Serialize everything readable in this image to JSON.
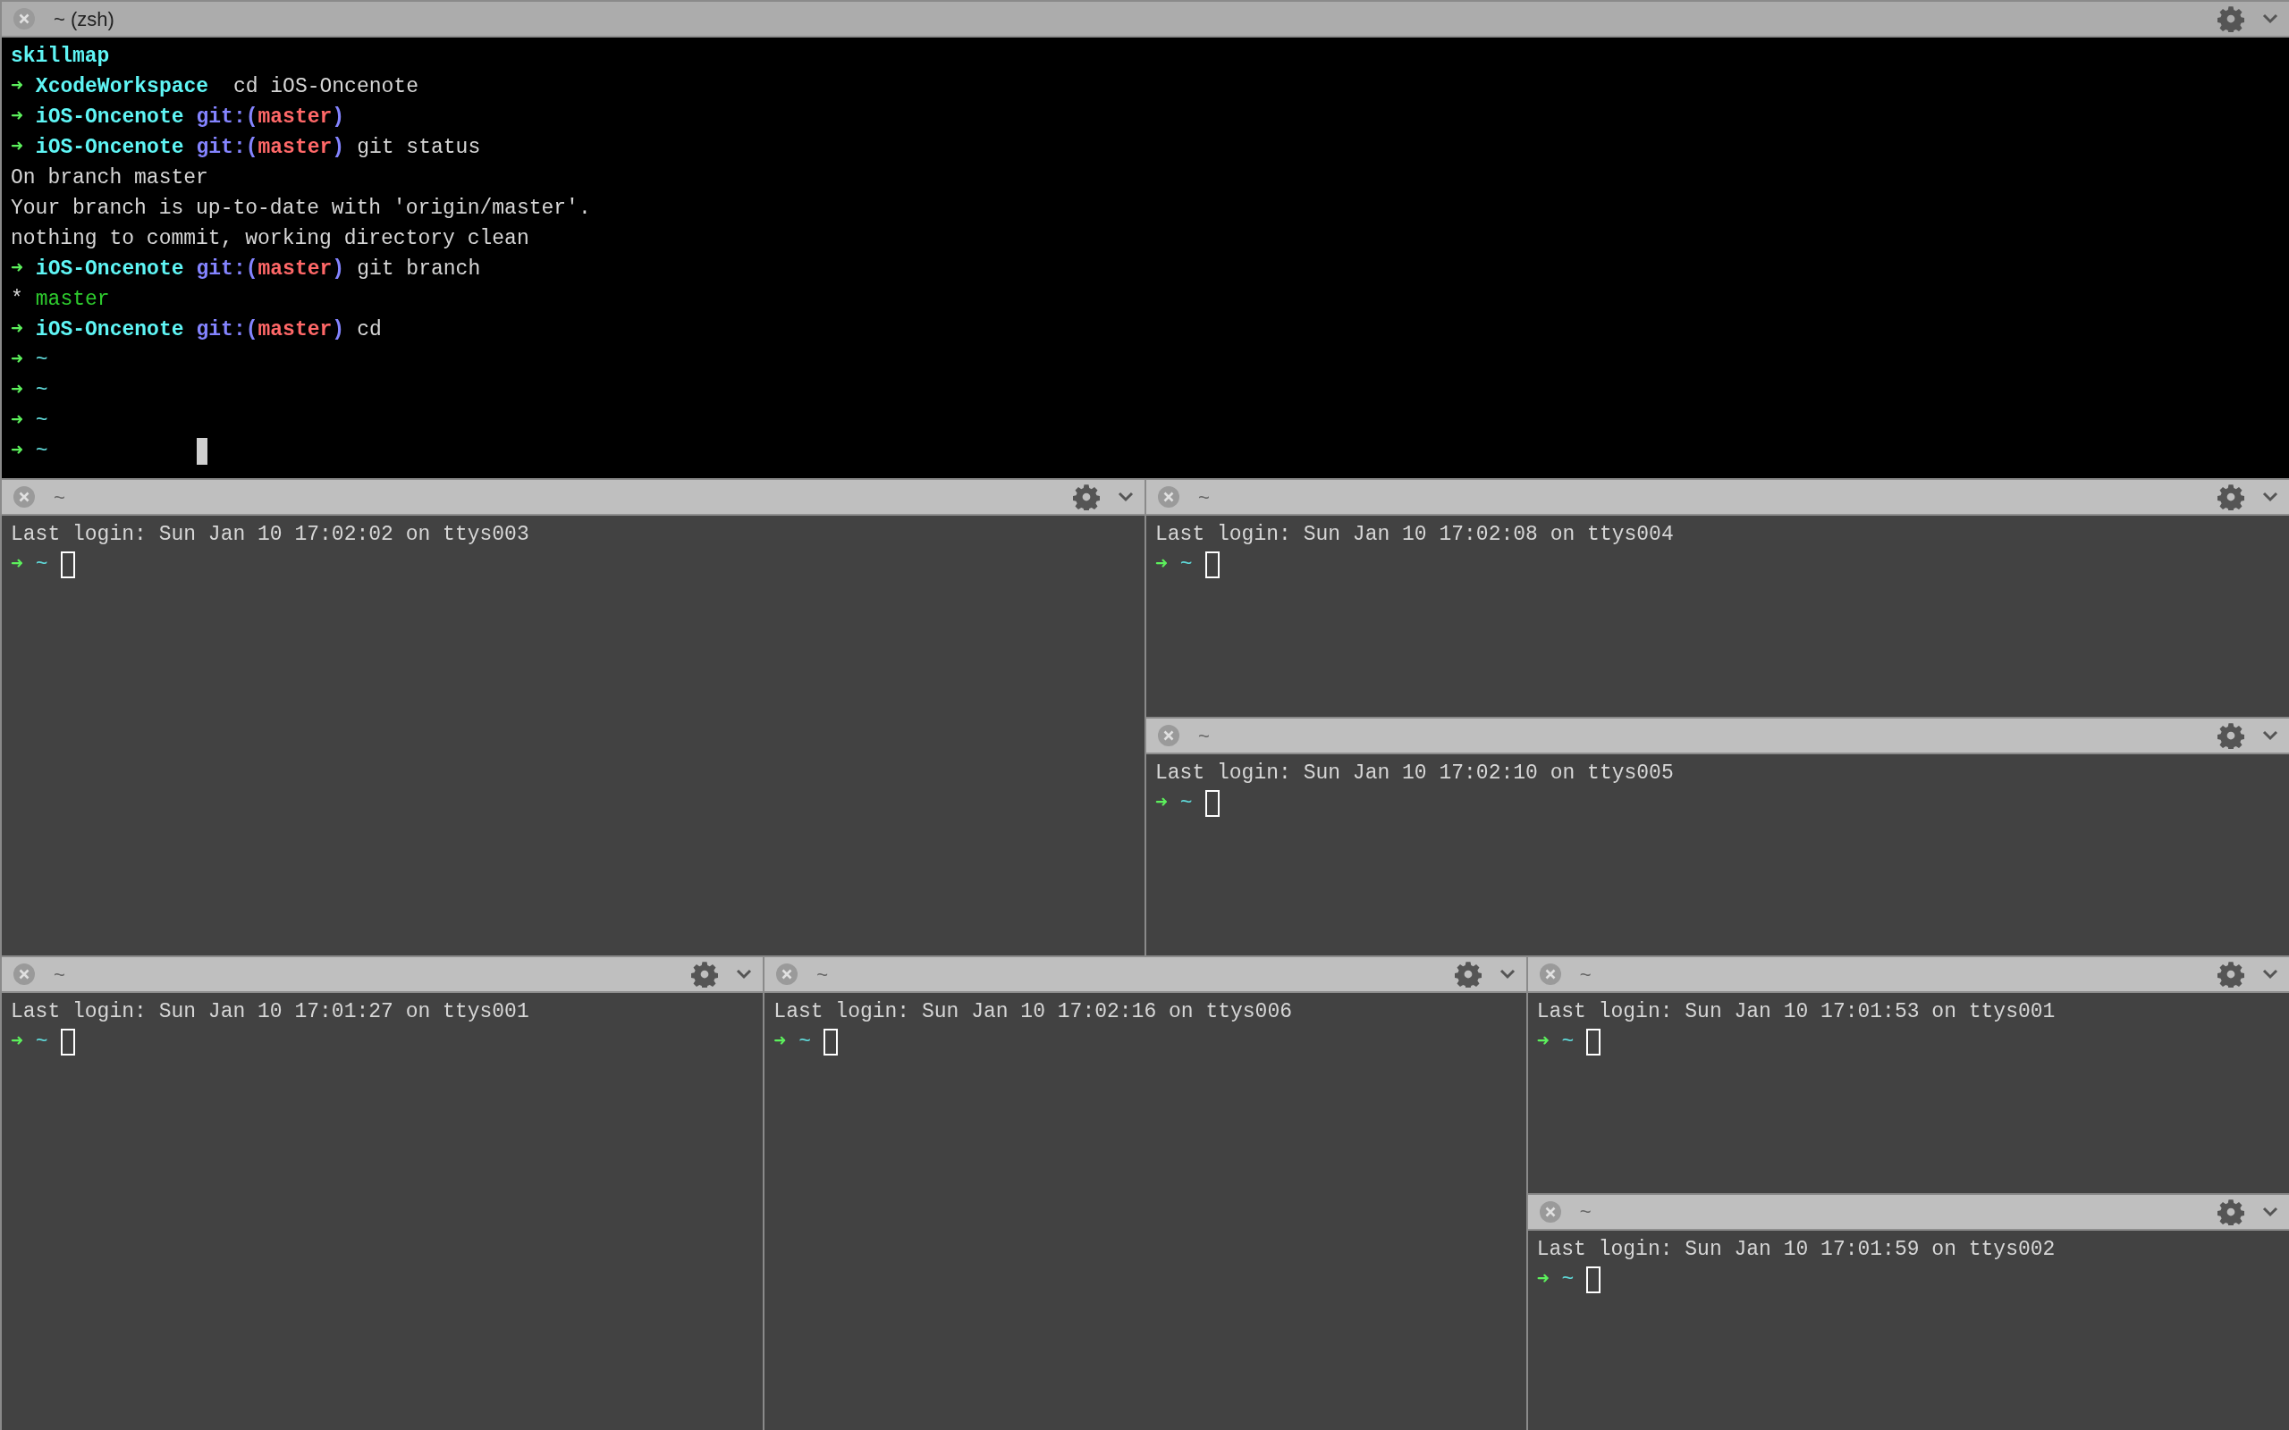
{
  "rows": [
    {
      "columns": [
        {
          "panes": [
            {
              "title": "~ (zsh)",
              "active": true,
              "lines": [
                [
                  {
                    "kind": "dir",
                    "text": "skillmap"
                  }
                ],
                [
                  {
                    "kind": "arrow",
                    "text": "➜"
                  },
                  {
                    "kind": "dir",
                    "text": "XcodeWorkspace"
                  },
                  {
                    "kind": "text",
                    "text": " cd iOS-Oncenote"
                  }
                ],
                [
                  {
                    "kind": "arrow",
                    "text": "➜"
                  },
                  {
                    "kind": "dir",
                    "text": "iOS-Oncenote"
                  },
                  {
                    "kind": "git",
                    "text": "git:("
                  },
                  {
                    "kind": "branch",
                    "text": "master"
                  },
                  {
                    "kind": "git",
                    "text": ")"
                  }
                ],
                [
                  {
                    "kind": "arrow",
                    "text": "➜"
                  },
                  {
                    "kind": "dir",
                    "text": "iOS-Oncenote"
                  },
                  {
                    "kind": "git",
                    "text": "git:("
                  },
                  {
                    "kind": "branch",
                    "text": "master"
                  },
                  {
                    "kind": "git",
                    "text": ")"
                  },
                  {
                    "kind": "text",
                    "text": "git status"
                  }
                ],
                [
                  {
                    "kind": "text",
                    "text": "On branch master"
                  }
                ],
                [
                  {
                    "kind": "text",
                    "text": "Your branch is up-to-date with 'origin/master'."
                  }
                ],
                [
                  {
                    "kind": "text",
                    "text": "nothing to commit, working directory clean"
                  }
                ],
                [
                  {
                    "kind": "arrow",
                    "text": "➜"
                  },
                  {
                    "kind": "dir",
                    "text": "iOS-Oncenote"
                  },
                  {
                    "kind": "git",
                    "text": "git:("
                  },
                  {
                    "kind": "branch",
                    "text": "master"
                  },
                  {
                    "kind": "git",
                    "text": ")"
                  },
                  {
                    "kind": "text",
                    "text": "git branch"
                  }
                ],
                [
                  {
                    "kind": "text",
                    "text": "*"
                  },
                  {
                    "kind": "green",
                    "text": "master"
                  }
                ],
                [
                  {
                    "kind": "arrow",
                    "text": "➜"
                  },
                  {
                    "kind": "dir",
                    "text": "iOS-Oncenote"
                  },
                  {
                    "kind": "git",
                    "text": "git:("
                  },
                  {
                    "kind": "branch",
                    "text": "master"
                  },
                  {
                    "kind": "git",
                    "text": ")"
                  },
                  {
                    "kind": "text",
                    "text": "cd"
                  }
                ],
                [
                  {
                    "kind": "arrow",
                    "text": "➜"
                  },
                  {
                    "kind": "tilde",
                    "text": "~"
                  }
                ],
                [
                  {
                    "kind": "arrow",
                    "text": "➜"
                  },
                  {
                    "kind": "tilde",
                    "text": "~"
                  }
                ],
                [
                  {
                    "kind": "arrow",
                    "text": "➜"
                  },
                  {
                    "kind": "tilde",
                    "text": "~"
                  }
                ],
                [
                  {
                    "kind": "arrow",
                    "text": "➜"
                  },
                  {
                    "kind": "tilde",
                    "text": "~"
                  },
                  {
                    "kind": "gap"
                  },
                  {
                    "kind": "cursor"
                  }
                ]
              ]
            }
          ]
        }
      ]
    },
    {
      "columns": [
        {
          "panes": [
            {
              "title": "~",
              "active": false,
              "lines": [
                [
                  {
                    "kind": "text",
                    "text": "Last login: Sun Jan 10 17:02:02 on ttys003"
                  }
                ],
                [
                  {
                    "kind": "arrow",
                    "text": "➜"
                  },
                  {
                    "kind": "tilde",
                    "text": "~"
                  },
                  {
                    "kind": "cursor"
                  }
                ]
              ]
            }
          ]
        },
        {
          "panes": [
            {
              "title": "~",
              "active": false,
              "lines": [
                [
                  {
                    "kind": "text",
                    "text": "Last login: Sun Jan 10 17:02:08 on ttys004"
                  }
                ],
                [
                  {
                    "kind": "arrow",
                    "text": "➜"
                  },
                  {
                    "kind": "tilde",
                    "text": "~"
                  },
                  {
                    "kind": "cursor"
                  }
                ]
              ]
            },
            {
              "title": "~",
              "active": false,
              "lines": [
                [
                  {
                    "kind": "text",
                    "text": "Last login: Sun Jan 10 17:02:10 on ttys005"
                  }
                ],
                [
                  {
                    "kind": "arrow",
                    "text": "➜"
                  },
                  {
                    "kind": "tilde",
                    "text": "~"
                  },
                  {
                    "kind": "cursor"
                  }
                ]
              ]
            }
          ]
        }
      ]
    },
    {
      "columns": [
        {
          "panes": [
            {
              "title": "~",
              "active": false,
              "lines": [
                [
                  {
                    "kind": "text",
                    "text": "Last login: Sun Jan 10 17:01:27 on ttys001"
                  }
                ],
                [
                  {
                    "kind": "arrow",
                    "text": "➜"
                  },
                  {
                    "kind": "tilde",
                    "text": "~"
                  },
                  {
                    "kind": "cursor"
                  }
                ]
              ]
            }
          ]
        },
        {
          "panes": [
            {
              "title": "~",
              "active": false,
              "lines": [
                [
                  {
                    "kind": "text",
                    "text": "Last login: Sun Jan 10 17:02:16 on ttys006"
                  }
                ],
                [
                  {
                    "kind": "arrow",
                    "text": "➜"
                  },
                  {
                    "kind": "tilde",
                    "text": "~"
                  },
                  {
                    "kind": "cursor"
                  }
                ]
              ]
            }
          ]
        },
        {
          "panes": [
            {
              "title": "~",
              "active": false,
              "lines": [
                [
                  {
                    "kind": "text",
                    "text": "Last login: Sun Jan 10 17:01:53 on ttys001"
                  }
                ],
                [
                  {
                    "kind": "arrow",
                    "text": "➜"
                  },
                  {
                    "kind": "tilde",
                    "text": "~"
                  },
                  {
                    "kind": "cursor"
                  }
                ]
              ]
            },
            {
              "title": "~",
              "active": false,
              "lines": [
                [
                  {
                    "kind": "text",
                    "text": "Last login: Sun Jan 10 17:01:59 on ttys002"
                  }
                ],
                [
                  {
                    "kind": "arrow",
                    "text": "➜"
                  },
                  {
                    "kind": "tilde",
                    "text": "~"
                  },
                  {
                    "kind": "cursor"
                  }
                ]
              ]
            }
          ]
        }
      ]
    }
  ]
}
